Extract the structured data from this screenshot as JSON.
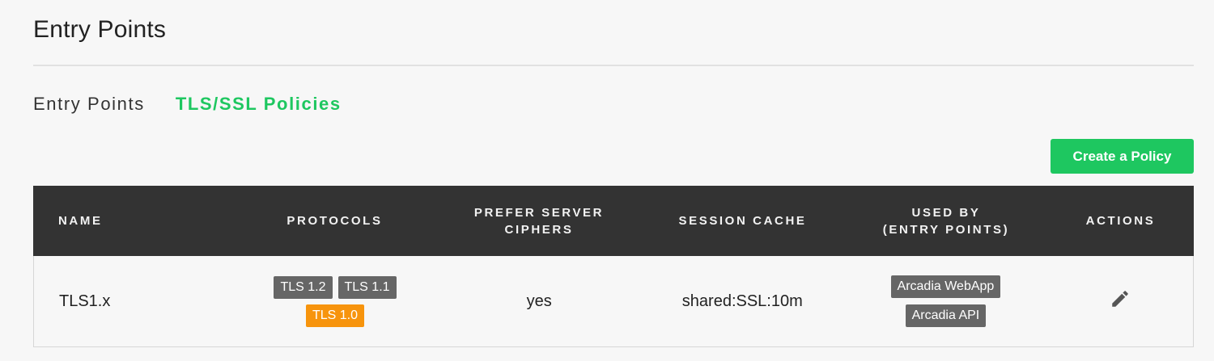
{
  "page": {
    "title": "Entry Points"
  },
  "tabs": [
    {
      "label": "Entry Points",
      "active": false
    },
    {
      "label": "TLS/SSL Policies",
      "active": true
    }
  ],
  "toolbar": {
    "create_label": "Create a Policy"
  },
  "table": {
    "headers": {
      "name": "NAME",
      "protocols": "PROTOCOLS",
      "prefer_line1": "PREFER SERVER",
      "prefer_line2": "CIPHERS",
      "session": "SESSION CACHE",
      "used_line1": "USED BY",
      "used_line2": "(ENTRY POINTS)",
      "actions": "ACTIONS"
    },
    "rows": [
      {
        "name": "TLS1.x",
        "protocols": [
          "TLS 1.2",
          "TLS 1.1",
          "TLS 1.0"
        ],
        "prefer_server_ciphers": "yes",
        "session_cache": "shared:SSL:10m",
        "used_by": [
          "Arcadia WebApp",
          "Arcadia API"
        ],
        "action_icon": "pencil-icon"
      }
    ]
  },
  "colors": {
    "accent": "#1ec760",
    "header_bg": "#333333",
    "badge": "#666666",
    "badge_warning": "#f7940d"
  }
}
